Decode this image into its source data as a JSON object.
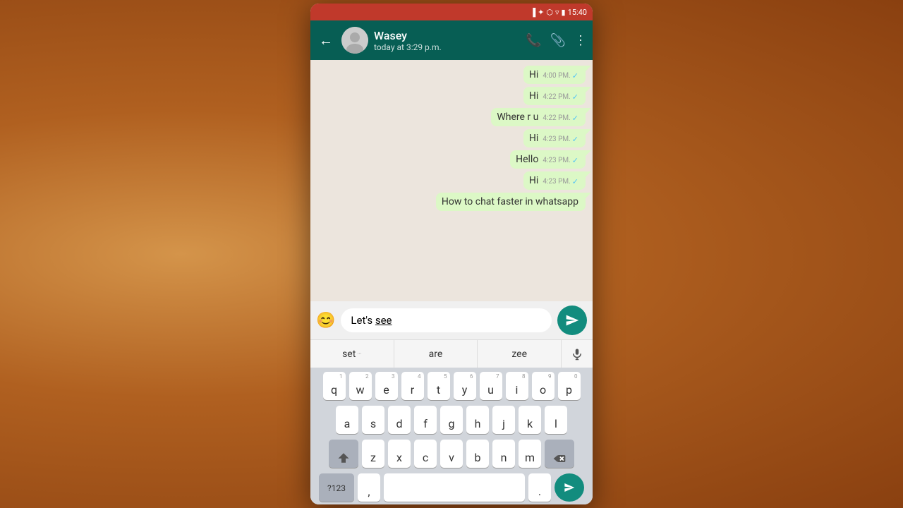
{
  "background": {
    "color": "#c97a3a"
  },
  "status_bar": {
    "time": "15:40",
    "icons": [
      "signal",
      "bluetooth",
      "notification",
      "wifi",
      "battery"
    ]
  },
  "header": {
    "contact_name": "Wasey",
    "contact_status": "today at 3:29 p.m.",
    "back_label": "←",
    "icons": [
      "phone",
      "attachment",
      "more"
    ]
  },
  "messages": [
    {
      "text": "Hi",
      "time": "4:00 PM.",
      "read": true
    },
    {
      "text": "Hi",
      "time": "4:22 PM.",
      "read": true
    },
    {
      "text": "Where r u",
      "time": "4:22 PM.",
      "read": true
    },
    {
      "text": "Hi",
      "time": "4:23 PM.",
      "read": true
    },
    {
      "text": "Hello",
      "time": "4:23 PM.",
      "read": true
    },
    {
      "text": "Hi",
      "time": "4:23 PM.",
      "read": true
    },
    {
      "text": "How to chat faster in whatsapp",
      "time": "",
      "read": false
    }
  ],
  "input": {
    "value": "Let's see",
    "emoji_label": "😊"
  },
  "suggestions": [
    {
      "label": "set",
      "has_dots": true
    },
    {
      "label": "are",
      "has_dots": false
    },
    {
      "label": "zee",
      "has_dots": false
    }
  ],
  "keyboard": {
    "rows": [
      [
        "q",
        "w",
        "e",
        "r",
        "t",
        "y",
        "u",
        "i",
        "o",
        "p"
      ],
      [
        "a",
        "s",
        "d",
        "f",
        "g",
        "h",
        "j",
        "k",
        "l"
      ],
      [
        "z",
        "x",
        "c",
        "v",
        "b",
        "n",
        "m"
      ]
    ],
    "numbers": [
      "1",
      "2",
      "3",
      "4",
      "5",
      "6",
      "7",
      "8",
      "9",
      "0"
    ],
    "special_left": "?123",
    "comma": ",",
    "period": ".",
    "send_label": "▶"
  }
}
